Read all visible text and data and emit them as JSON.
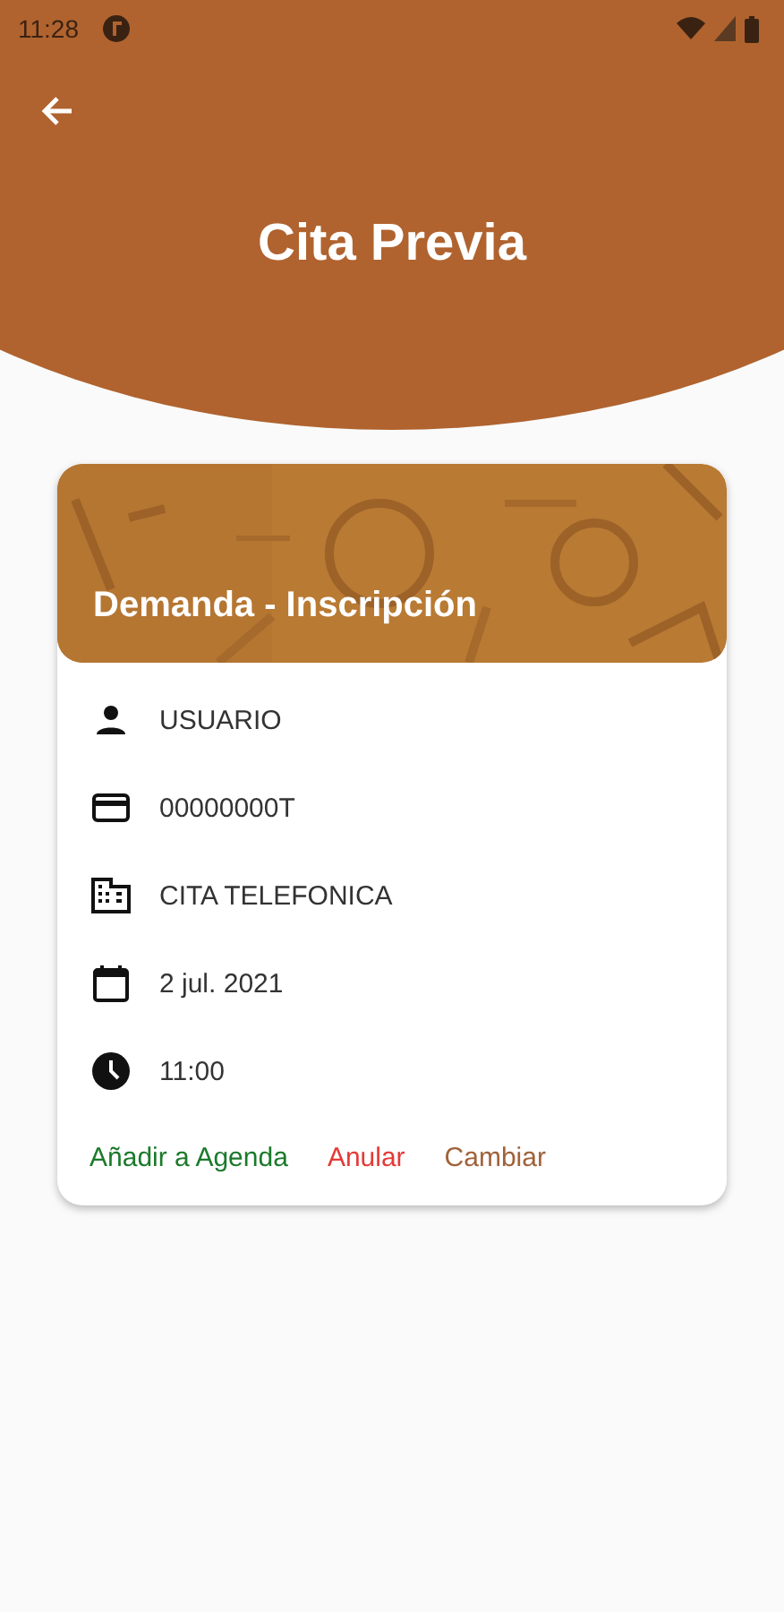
{
  "status_bar": {
    "time": "11:28"
  },
  "app_bar": {
    "title": "Cita Previa"
  },
  "card": {
    "title": "Demanda - Inscripción",
    "details": [
      {
        "kind": "person",
        "text": "USUARIO"
      },
      {
        "kind": "card",
        "text": "00000000T"
      },
      {
        "kind": "building",
        "text": "CITA TELEFONICA"
      },
      {
        "kind": "calendar",
        "text": "2 jul. 2021"
      },
      {
        "kind": "clock",
        "text": "11:00"
      }
    ],
    "actions": [
      {
        "label": "Añadir a Agenda",
        "color": "#1b7a2a"
      },
      {
        "label": "Anular",
        "color": "#e53935"
      },
      {
        "label": "Cambiar",
        "color": "#a0623a"
      }
    ]
  }
}
